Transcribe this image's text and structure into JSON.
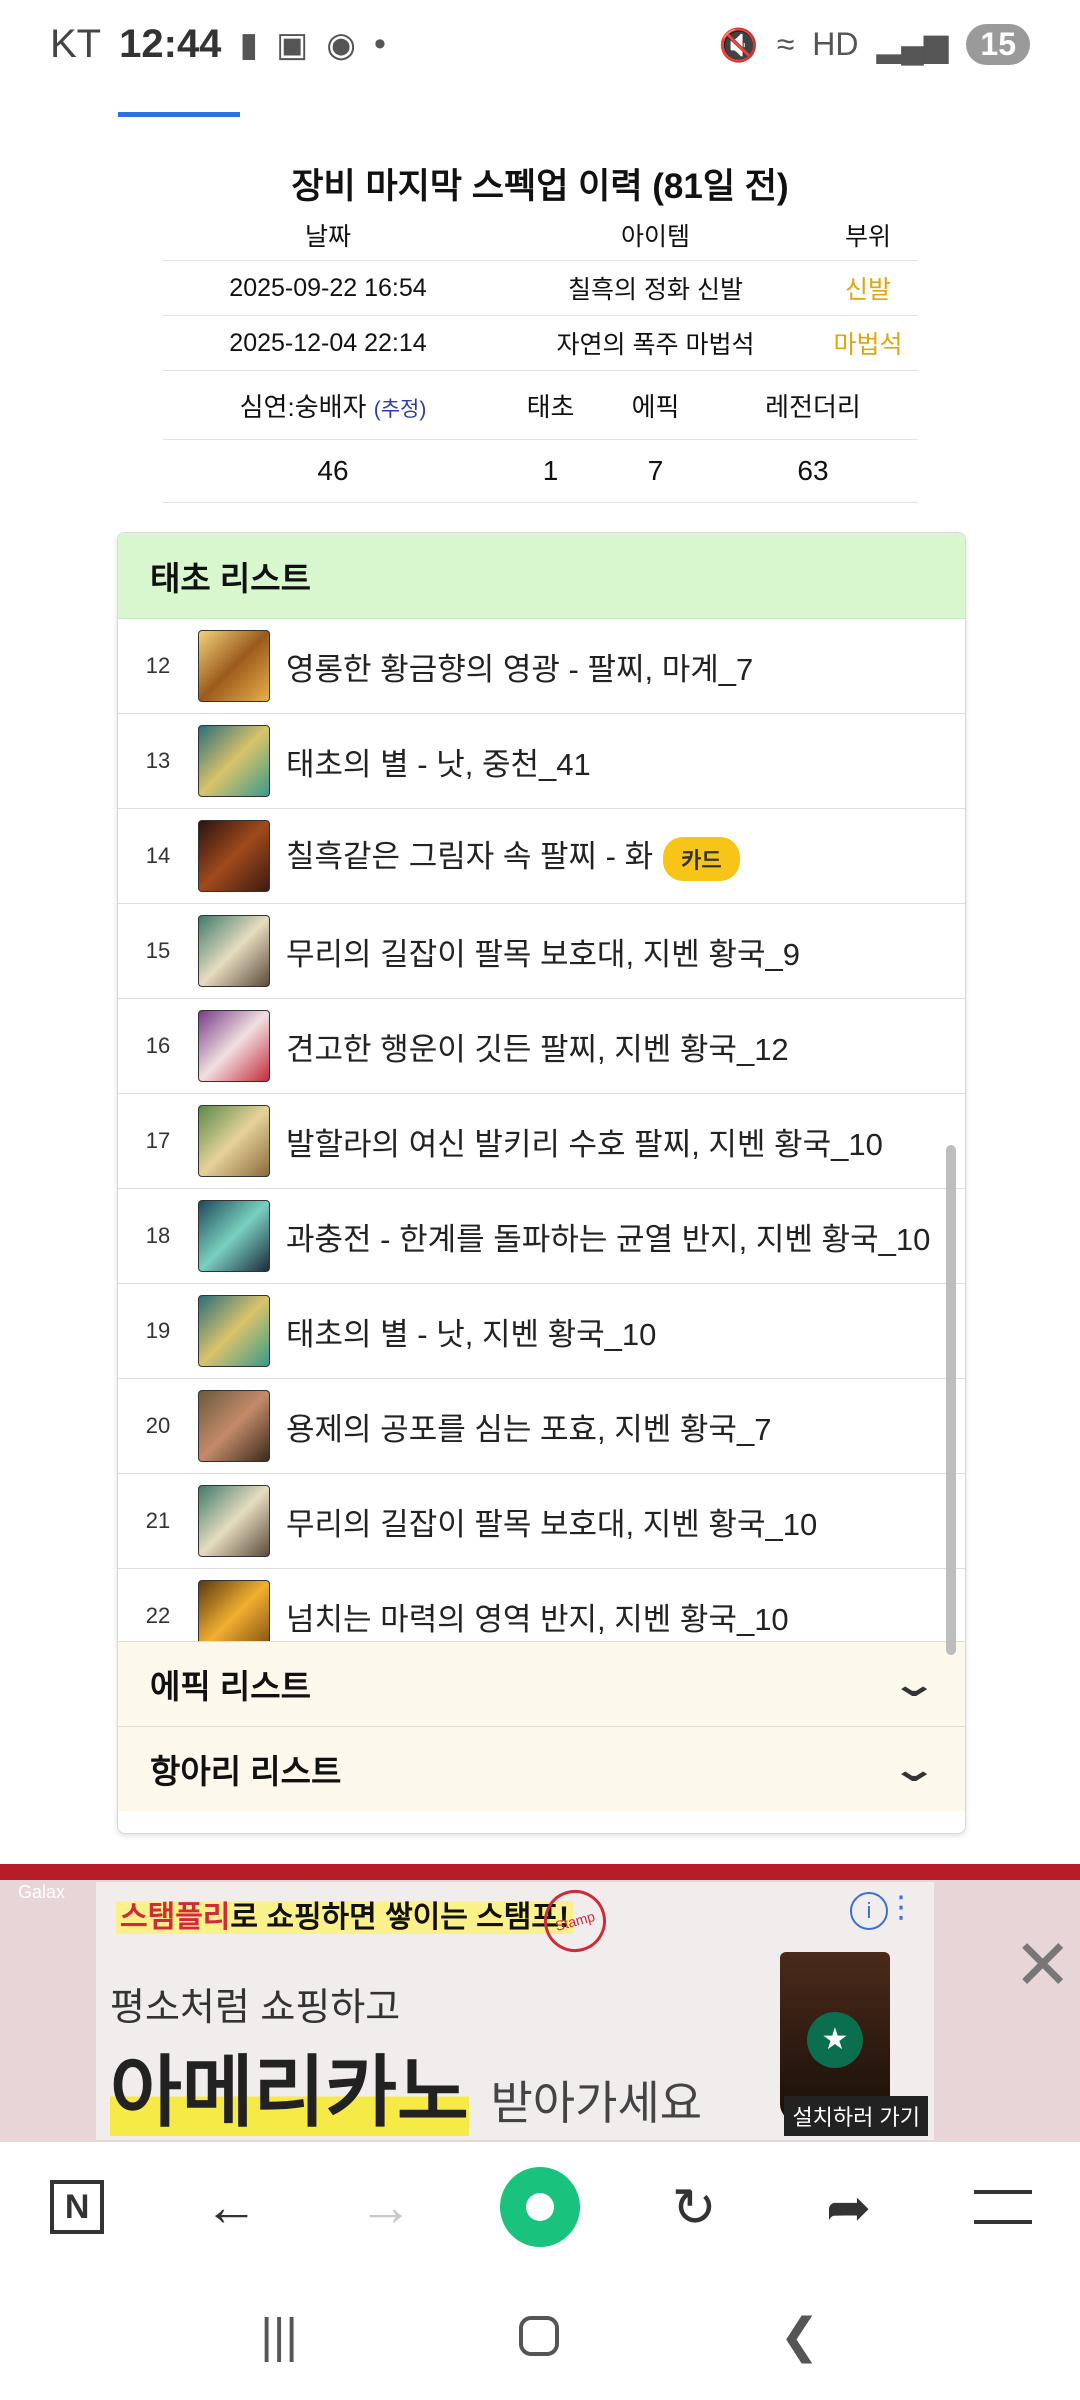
{
  "status_bar": {
    "carrier": "KT",
    "time": "12:44",
    "battery": "15"
  },
  "spec": {
    "title": "장비 마지막 스펙업 이력 (81일 전)",
    "headers": {
      "date": "날짜",
      "item": "아이템",
      "part": "부위"
    },
    "rows": [
      {
        "date": "2025-09-22 16:54",
        "item": "칠흑의 정화 신발",
        "part": "신발"
      },
      {
        "date": "2025-12-04 22:14",
        "item": "자연의 폭주 마법석",
        "part": "마법석"
      }
    ],
    "part_color": "#e0a612"
  },
  "counts": {
    "labels": {
      "first": "심연:숭배자",
      "estimate": "(추정)",
      "taecho": "태초",
      "epic": "에픽",
      "legendary": "레전더리"
    },
    "values": {
      "first": "46",
      "taecho": "1",
      "epic": "7",
      "legendary": "63"
    }
  },
  "taecho_list": {
    "title": "태초 리스트",
    "header_color": "#d9f7cf",
    "items": [
      {
        "num": "12",
        "name": "영롱한 황금향의 영광 - 팔찌, 마계_7",
        "icon": "golden-bracelet-icon"
      },
      {
        "num": "13",
        "name": "태초의 별 - 낫, 중천_41",
        "icon": "star-scythe-icon"
      },
      {
        "num": "14",
        "name": "칠흑같은 그림자 속 팔찌 - 화",
        "icon": "shadow-bracelet-icon",
        "badge": "카드"
      },
      {
        "num": "15",
        "name": "무리의 길잡이 팔목 보호대, 지벤 황국_9",
        "icon": "wrist-guard-icon"
      },
      {
        "num": "16",
        "name": "견고한 행운이 깃든 팔찌, 지벤 황국_12",
        "icon": "luck-bracelet-icon"
      },
      {
        "num": "17",
        "name": "발할라의 여신 발키리 수호 팔찌, 지벤 황국_10",
        "icon": "valkyrie-bracelet-icon"
      },
      {
        "num": "18",
        "name": "과충전 - 한계를 돌파하는 균열 반지, 지벤 황국_10",
        "icon": "rift-ring-icon"
      },
      {
        "num": "19",
        "name": "태초의 별 - 낫, 지벤 황국_10",
        "icon": "star-scythe-icon"
      },
      {
        "num": "20",
        "name": "용제의 공포를 심는 포효, 지벤 황국_7",
        "icon": "dragon-roar-icon"
      },
      {
        "num": "21",
        "name": "무리의 길잡이 팔목 보호대, 지벤 황국_10",
        "icon": "wrist-guard-icon"
      },
      {
        "num": "22",
        "name": "넘치는 마력의 영역 반지, 지벤 황국_10",
        "icon": "mana-ring-icon"
      }
    ]
  },
  "accordions": [
    {
      "title": "에픽 리스트"
    },
    {
      "title": "항아리 리스트"
    }
  ],
  "ad": {
    "brand": "스탬플리",
    "line1_rest": "로 쇼핑하면 쌓이는 스탬프!",
    "stamp": "Stamp",
    "line2": "평소처럼 쇼핑하고",
    "line3_big": "아메리카노",
    "line3_small": "받아가세요",
    "install": "설치하러 가기",
    "gal": "Galax"
  },
  "browser_bar": {
    "n_label": "N"
  }
}
